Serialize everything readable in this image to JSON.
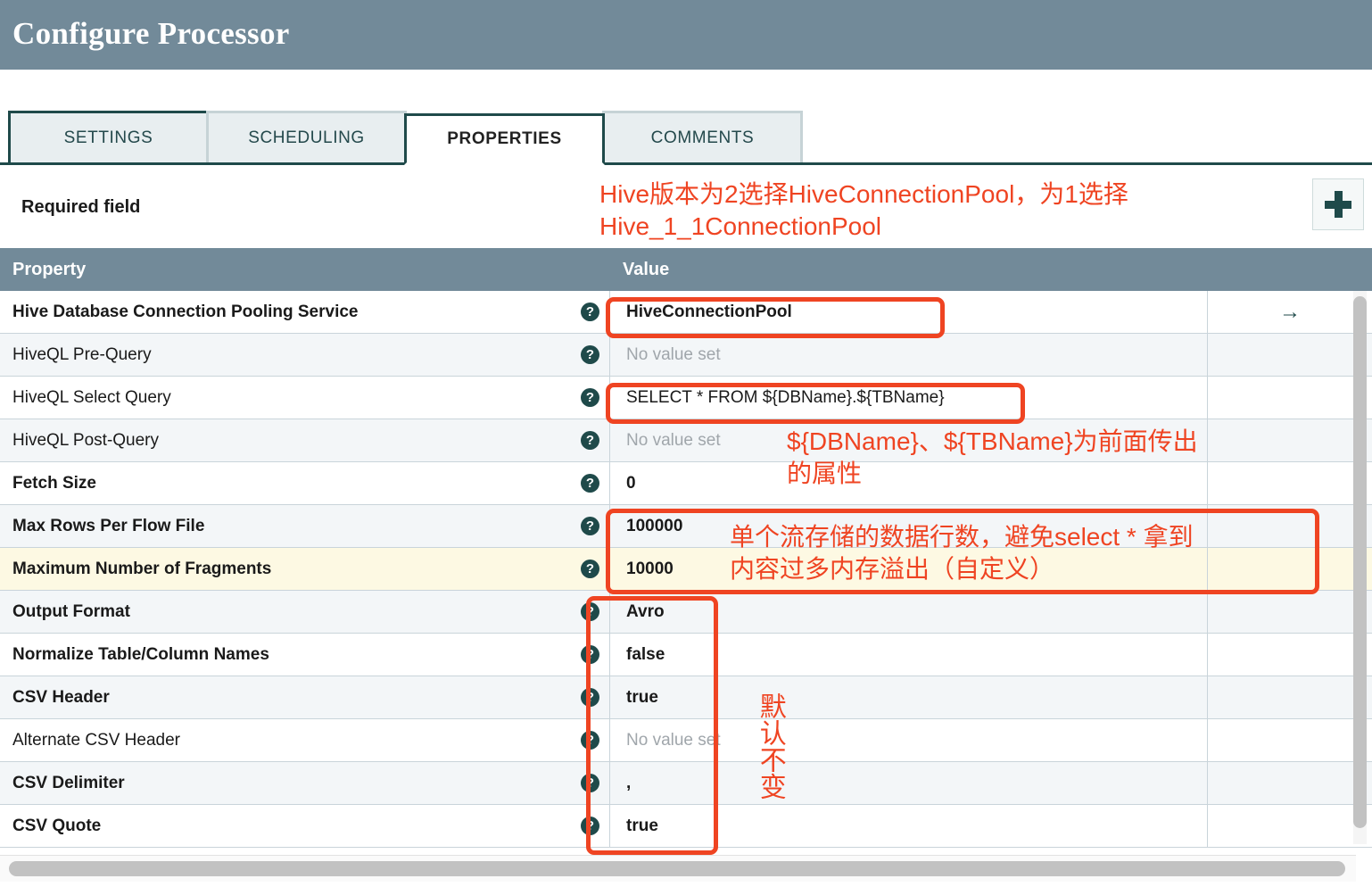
{
  "window": {
    "title": "Configure Processor"
  },
  "tabs": [
    {
      "label": "SETTINGS",
      "active": false
    },
    {
      "label": "SCHEDULING",
      "active": false
    },
    {
      "label": "PROPERTIES",
      "active": true
    },
    {
      "label": "COMMENTS",
      "active": false
    }
  ],
  "toolbar": {
    "required_field_label": "Required field",
    "add_property_icon": "plus-icon"
  },
  "table": {
    "columns": [
      "Property",
      "Value"
    ],
    "no_value_text": "No value set",
    "goto_arrow": "→",
    "help_icon_glyph": "?",
    "rows": [
      {
        "property": "Hive Database Connection Pooling Service",
        "required": true,
        "value": "HiveConnectionPool",
        "has_value": true,
        "end": "→"
      },
      {
        "property": "HiveQL Pre-Query",
        "required": false,
        "value": "No value set",
        "has_value": false,
        "end": ""
      },
      {
        "property": "HiveQL Select Query",
        "required": false,
        "value": "SELECT * FROM ${DBName}.${TBName}",
        "has_value": true,
        "plain": true,
        "end": ""
      },
      {
        "property": "HiveQL Post-Query",
        "required": false,
        "value": "No value set",
        "has_value": false,
        "end": ""
      },
      {
        "property": "Fetch Size",
        "required": true,
        "value": "0",
        "has_value": true,
        "end": ""
      },
      {
        "property": "Max Rows Per Flow File",
        "required": true,
        "value": "100000",
        "has_value": true,
        "end": ""
      },
      {
        "property": "Maximum Number of Fragments",
        "required": true,
        "value": "10000",
        "has_value": true,
        "end": "",
        "highlight": true
      },
      {
        "property": "Output Format",
        "required": true,
        "value": "Avro",
        "has_value": true,
        "end": ""
      },
      {
        "property": "Normalize Table/Column Names",
        "required": true,
        "value": "false",
        "has_value": true,
        "end": ""
      },
      {
        "property": "CSV Header",
        "required": true,
        "value": "true",
        "has_value": true,
        "end": ""
      },
      {
        "property": "Alternate CSV Header",
        "required": false,
        "value": "No value set",
        "has_value": false,
        "end": ""
      },
      {
        "property": "CSV Delimiter",
        "required": true,
        "value": ",",
        "has_value": true,
        "end": ""
      },
      {
        "property": "CSV Quote",
        "required": true,
        "value": "true",
        "has_value": true,
        "end": ""
      }
    ]
  },
  "annotations": {
    "color": "#ef4422",
    "connection_pool_note": "Hive版本为2选择HiveConnectionPool，为1选择\nHive_1_1ConnectionPool",
    "query_vars_note": "${DBName}、${TBName}为前面传出\n的属性",
    "max_rows_note": "单个流存储的数据行数，避免select * 拿到\n内容过多内存溢出（自定义）",
    "defaults_note": "默认不变"
  }
}
